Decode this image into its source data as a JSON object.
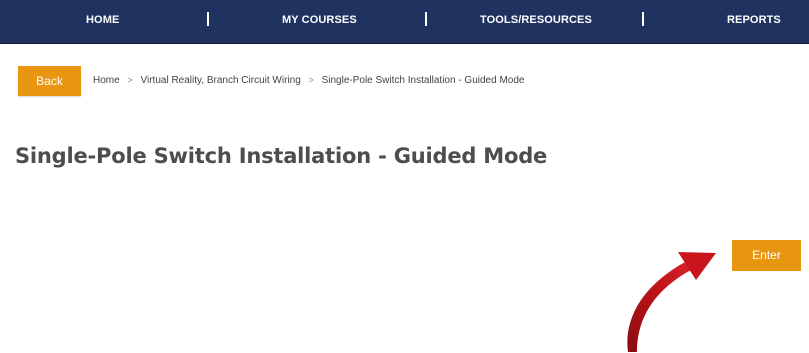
{
  "nav": {
    "items": [
      {
        "label": "HOME"
      },
      {
        "label": "MY COURSES"
      },
      {
        "label": "TOOLS/RESOURCES"
      },
      {
        "label": "REPORTS"
      }
    ]
  },
  "actions": {
    "back_label": "Back",
    "enter_label": "Enter"
  },
  "breadcrumb": {
    "items": [
      {
        "label": "Home"
      },
      {
        "label": "Virtual Reality, Branch Circuit Wiring"
      },
      {
        "label": "Single-Pole Switch Installation - Guided Mode"
      }
    ],
    "separator": ">"
  },
  "page": {
    "title": "Single-Pole Switch Installation - Guided Mode"
  },
  "annotation": {
    "icon": "curved-arrow-icon",
    "color": "#c0141a"
  },
  "colors": {
    "nav_background": "#1f3260",
    "button_accent": "#e8960f",
    "title_text": "#4d4d4d"
  }
}
